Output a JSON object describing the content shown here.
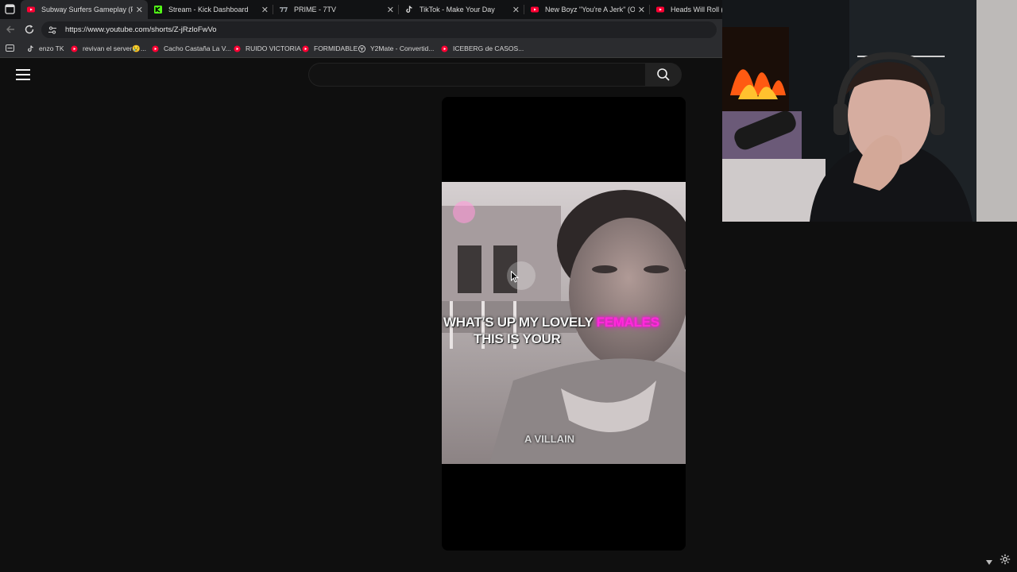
{
  "browser": {
    "tabs": [
      {
        "title": "Subway Surfers Gameplay (PC U",
        "icon": "youtube-icon",
        "active": true
      },
      {
        "title": "Stream - Kick Dashboard",
        "icon": "kick-icon",
        "active": false
      },
      {
        "title": "PRIME - 7TV",
        "icon": "7tv-icon",
        "active": false
      },
      {
        "title": "TikTok - Make Your Day",
        "icon": "tiktok-icon",
        "active": false
      },
      {
        "title": "New Boyz \"You're A Jerk\" (Officia",
        "icon": "youtube-icon",
        "active": false
      },
      {
        "title": "Heads Will Roll (A-T",
        "icon": "youtube-icon",
        "active": false
      }
    ],
    "url": "https://www.youtube.com/shorts/Z-jRzloFwVo",
    "bookmarks": [
      {
        "label": "enzo TK",
        "icon": "tiktok-icon"
      },
      {
        "label": "revivan el server😢...",
        "icon": "youtube-icon"
      },
      {
        "label": "Cacho Castaña La V...",
        "icon": "youtube-icon"
      },
      {
        "label": "RUIDO VICTORIA",
        "icon": "youtube-icon"
      },
      {
        "label": "FORMIDABLE",
        "icon": "youtube-icon"
      },
      {
        "label": "Y2Mate - Convertid...",
        "icon": "y2mate-icon"
      },
      {
        "label": "ICEBERG de CASOS...",
        "icon": "youtube-icon"
      }
    ]
  },
  "youtube": {
    "search_value": "",
    "short": {
      "caption_line1": "WHAT'S UP MY LOVELY ",
      "caption_highlight": "FEMALES",
      "caption_line2": "THIS IS YOUR",
      "caption_line3": "A VILLAIN"
    }
  },
  "colors": {
    "youtube_red": "#ff0033",
    "highlight_pink": "#ff2bd9",
    "kick_green": "#53fc18"
  }
}
